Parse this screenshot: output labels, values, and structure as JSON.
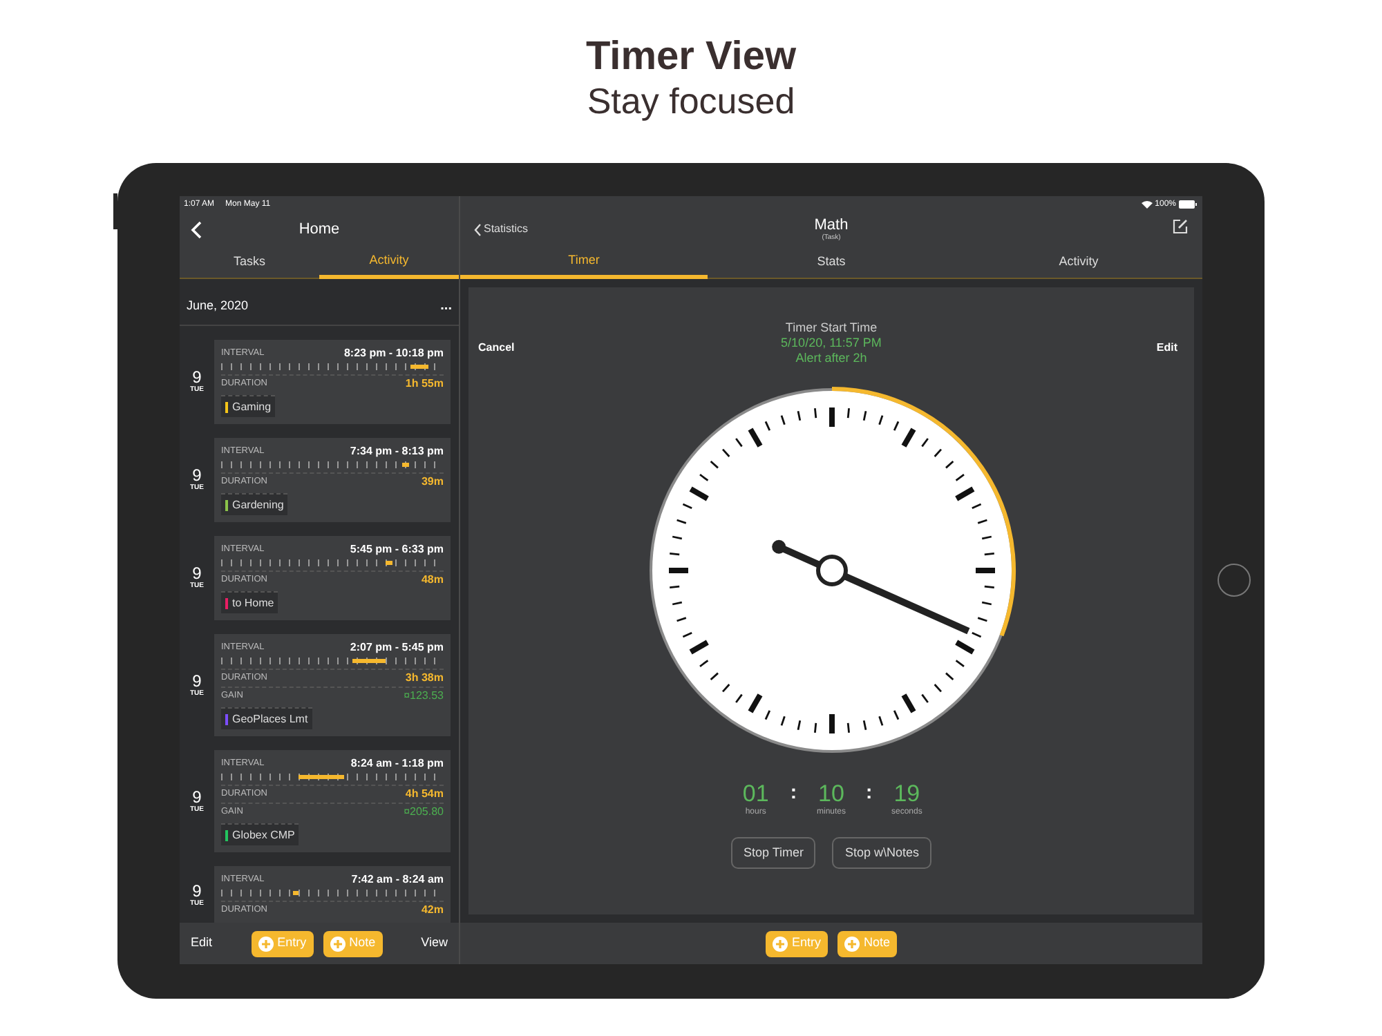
{
  "header": {
    "title": "Timer View",
    "subtitle": "Stay focused"
  },
  "status_bar": {
    "time": "1:07 AM",
    "date": "Mon May 11",
    "battery": "100%"
  },
  "left_panel": {
    "nav_title": "Home",
    "tabs": [
      {
        "label": "Tasks",
        "selected": false
      },
      {
        "label": "Activity",
        "selected": true
      }
    ],
    "month": "June, 2020",
    "menu": "...",
    "entries": [
      {
        "day": "9",
        "weekday": "TUE",
        "fields": [
          {
            "kind": "interval",
            "label": "INTERVAL",
            "value": "8:23 pm - 10:18 pm"
          },
          {
            "kind": "duration",
            "label": "DURATION",
            "value": "1h 55m"
          }
        ],
        "tag": {
          "name": "Gaming",
          "color": "#f5c518"
        }
      },
      {
        "day": "9",
        "weekday": "TUE",
        "fields": [
          {
            "kind": "interval",
            "label": "INTERVAL",
            "value": "7:34 pm - 8:13 pm"
          },
          {
            "kind": "duration",
            "label": "DURATION",
            "value": "39m"
          }
        ],
        "tag": {
          "name": "Gardening",
          "color": "#8bc34a"
        }
      },
      {
        "day": "9",
        "weekday": "TUE",
        "fields": [
          {
            "kind": "interval",
            "label": "INTERVAL",
            "value": "5:45 pm - 6:33 pm"
          },
          {
            "kind": "duration",
            "label": "DURATION",
            "value": "48m"
          }
        ],
        "tag": {
          "name": "to Home",
          "color": "#e91e63"
        }
      },
      {
        "day": "9",
        "weekday": "TUE",
        "fields": [
          {
            "kind": "interval",
            "label": "INTERVAL",
            "value": "2:07 pm - 5:45 pm"
          },
          {
            "kind": "duration",
            "label": "DURATION",
            "value": "3h 38m"
          },
          {
            "kind": "gain",
            "label": "GAIN",
            "value": "¤123.53"
          }
        ],
        "tag": {
          "name": "GeoPlaces Lmt",
          "color": "#7c4dff"
        }
      },
      {
        "day": "9",
        "weekday": "TUE",
        "fields": [
          {
            "kind": "interval",
            "label": "INTERVAL",
            "value": "8:24 am - 1:18 pm"
          },
          {
            "kind": "duration",
            "label": "DURATION",
            "value": "4h 54m"
          },
          {
            "kind": "gain",
            "label": "GAIN",
            "value": "¤205.80"
          }
        ],
        "tag": {
          "name": "Globex CMP",
          "color": "#22c55e"
        }
      },
      {
        "day": "9",
        "weekday": "TUE",
        "fields": [
          {
            "kind": "interval",
            "label": "INTERVAL",
            "value": "7:42 am - 8:24 am"
          },
          {
            "kind": "duration",
            "label": "DURATION",
            "value": "42m"
          }
        ]
      }
    ],
    "toolbar": {
      "edit": "Edit",
      "buttons": [
        "Entry",
        "Note"
      ],
      "view": "View"
    }
  },
  "right_panel": {
    "back": "Statistics",
    "title": "Math",
    "subtitle": "(Task)",
    "tabs": [
      {
        "label": "Timer",
        "selected": true
      },
      {
        "label": "Stats",
        "selected": false
      },
      {
        "label": "Activity",
        "selected": false
      }
    ],
    "timer": {
      "cancel": "Cancel",
      "edit": "Edit",
      "start_label": "Timer Start Time",
      "start_time": "5/10/20, 11:57 PM",
      "alert": "Alert after 2h",
      "readout": [
        {
          "kind": "number",
          "value": "01",
          "label": "hours"
        },
        {
          "kind": "separator",
          "value": ":"
        },
        {
          "kind": "number",
          "value": "10",
          "label": "minutes"
        },
        {
          "kind": "separator",
          "value": ":"
        },
        {
          "kind": "number",
          "value": "19",
          "label": "seconds"
        }
      ],
      "buttons": [
        "Stop Timer",
        "Stop w\\Notes"
      ]
    },
    "toolbar_buttons": [
      "Entry",
      "Note"
    ]
  }
}
